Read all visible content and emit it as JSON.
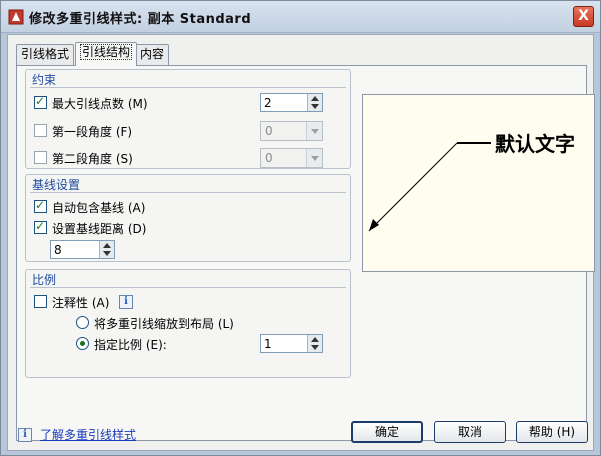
{
  "window": {
    "title": "修改多重引线样式: 副本 Standard",
    "close_label": "X"
  },
  "tabs": [
    {
      "label": "引线格式"
    },
    {
      "label": "引线结构"
    },
    {
      "label": "内容"
    }
  ],
  "constraints": {
    "title": "约束",
    "max_points": {
      "label": "最大引线点数 (M)",
      "checked": true,
      "value": "2"
    },
    "first_angle": {
      "label": "第一段角度 (F)",
      "checked": false,
      "value": "0"
    },
    "second_angle": {
      "label": "第二段角度 (S)",
      "checked": false,
      "value": "0"
    }
  },
  "landing": {
    "title": "基线设置",
    "auto_include": {
      "label": "自动包含基线 (A)",
      "checked": true
    },
    "set_distance": {
      "label": "设置基线距离 (D)",
      "checked": true
    },
    "distance_value": "8"
  },
  "scale": {
    "title": "比例",
    "annotative": {
      "label": "注释性 (A)",
      "checked": false
    },
    "info_icon": "i",
    "scale_to_layout": {
      "label": "将多重引线缩放到布局 (L)",
      "selected": false
    },
    "specify_scale": {
      "label": "指定比例 (E):",
      "selected": true
    },
    "scale_value": "1"
  },
  "preview": {
    "default_text": "默认文字"
  },
  "footer": {
    "help_link": "了解多重引线样式",
    "info_icon": "i",
    "ok_label": "确定",
    "cancel_label": "取消",
    "help_label": "帮助 (H)"
  },
  "colors": {
    "title_bar": "#c2d0e1",
    "group_title": "#1f4aa0",
    "close_button": "#c5391f"
  }
}
